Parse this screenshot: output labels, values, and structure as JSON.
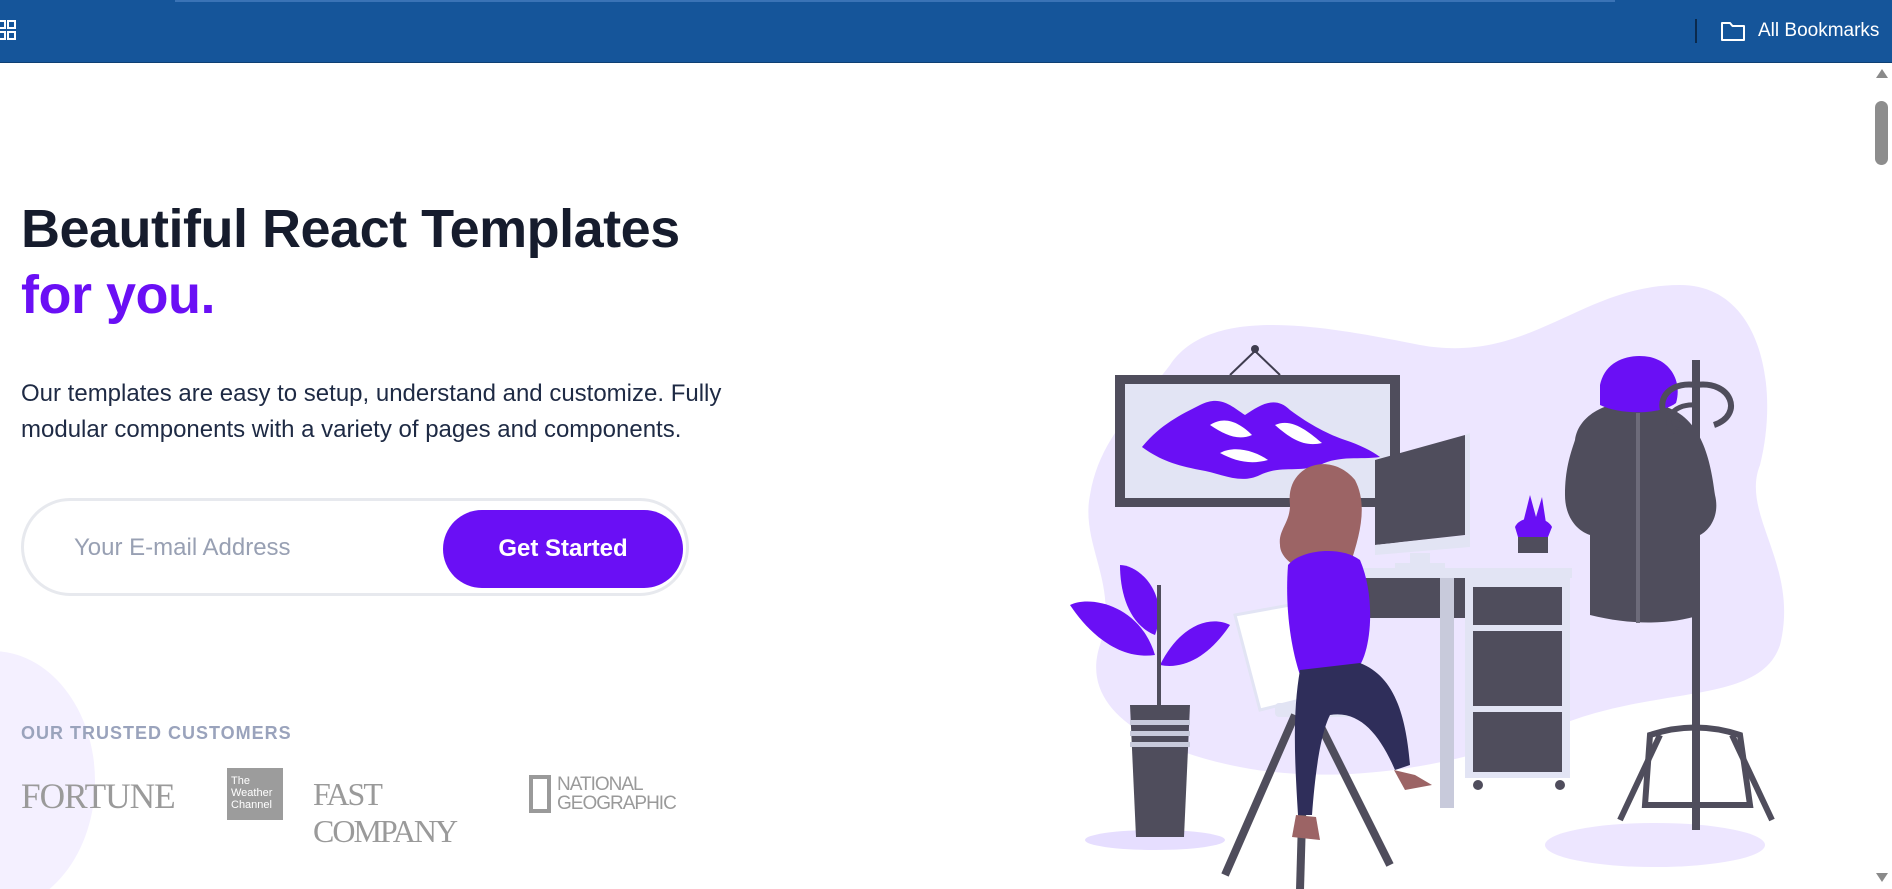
{
  "browser": {
    "bookmarks_folder_label": "All Bookmarks",
    "icons": [
      "apps-grid-icon",
      "folder-icon"
    ],
    "bar_color": "#15559a"
  },
  "hero": {
    "headline_line1": "Beautiful React Templates",
    "headline_line2": "for you.",
    "lead": "Our templates are easy to setup, understand and customize. Fully modular components with a variety of pages and components.",
    "email_placeholder": "Your E-mail Address",
    "email_value": "",
    "cta_label": "Get Started"
  },
  "customers": {
    "label": "OUR TRUSTED CUSTOMERS",
    "logos": {
      "fortune": "FORTUNE",
      "weather_line1": "The",
      "weather_line2": "Weather",
      "weather_line3": "Channel",
      "fastcompany": "FAST COMPANY",
      "natgeo_line1": "NATIONAL",
      "natgeo_line2": "GEOGRAPHIC"
    }
  },
  "colors": {
    "accent": "#6a0ff5",
    "heading": "#161c2d",
    "body_text": "#1e2a44",
    "muted": "#9aa3bc",
    "illustration_bg": "#ede6ff",
    "illustration_dark": "#4f4d5c"
  },
  "illustration": {
    "icon": "person-at-desk-illustration"
  }
}
